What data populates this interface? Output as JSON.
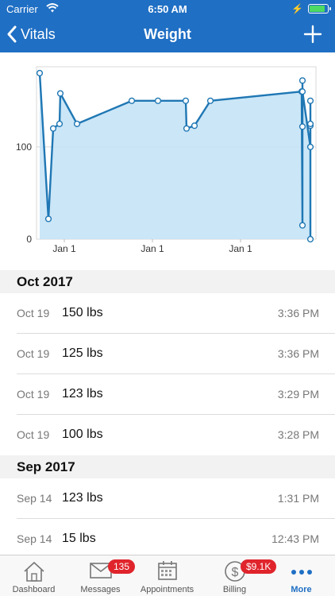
{
  "status_bar": {
    "carrier": "Carrier",
    "time": "6:50 AM"
  },
  "nav": {
    "back_label": "Vitals",
    "title": "Weight"
  },
  "chart_data": {
    "type": "area",
    "x_tick_labels": [
      "Jan 1",
      "Jan 1",
      "Jan 1"
    ],
    "y_tick_labels": [
      "0",
      "100"
    ],
    "ylim": [
      0,
      180
    ],
    "grid": true,
    "points": [
      180,
      22,
      120,
      125,
      158,
      125,
      150,
      150,
      150,
      120,
      123,
      150,
      160,
      15,
      122,
      172,
      160,
      100,
      150,
      123,
      125,
      0
    ],
    "colors": {
      "line": "#1f77b4",
      "fill": "#c5e3f6"
    }
  },
  "sections": [
    {
      "header": "Oct 2017",
      "rows": [
        {
          "date": "Oct 19",
          "value": "150 lbs",
          "time": "3:36 PM"
        },
        {
          "date": "Oct 19",
          "value": "125 lbs",
          "time": "3:36 PM"
        },
        {
          "date": "Oct 19",
          "value": "123 lbs",
          "time": "3:29 PM"
        },
        {
          "date": "Oct 19",
          "value": "100 lbs",
          "time": "3:28 PM"
        }
      ]
    },
    {
      "header": "Sep 2017",
      "rows": [
        {
          "date": "Sep 14",
          "value": "123 lbs",
          "time": "1:31 PM"
        },
        {
          "date": "Sep 14",
          "value": "15 lbs",
          "time": "12:43 PM"
        }
      ]
    }
  ],
  "tabs": [
    {
      "label": "Dashboard",
      "icon": "house-icon",
      "badge": ""
    },
    {
      "label": "Messages",
      "icon": "envelope-icon",
      "badge": "135"
    },
    {
      "label": "Appointments",
      "icon": "calendar-icon",
      "badge": ""
    },
    {
      "label": "Billing",
      "icon": "dollar-icon",
      "badge": "$9.1K"
    },
    {
      "label": "More",
      "icon": "ellipsis-icon",
      "badge": ""
    }
  ],
  "colors": {
    "nav": "#1f6fc4",
    "badge": "#e0242c",
    "active_tab": "#1f6fc4"
  }
}
